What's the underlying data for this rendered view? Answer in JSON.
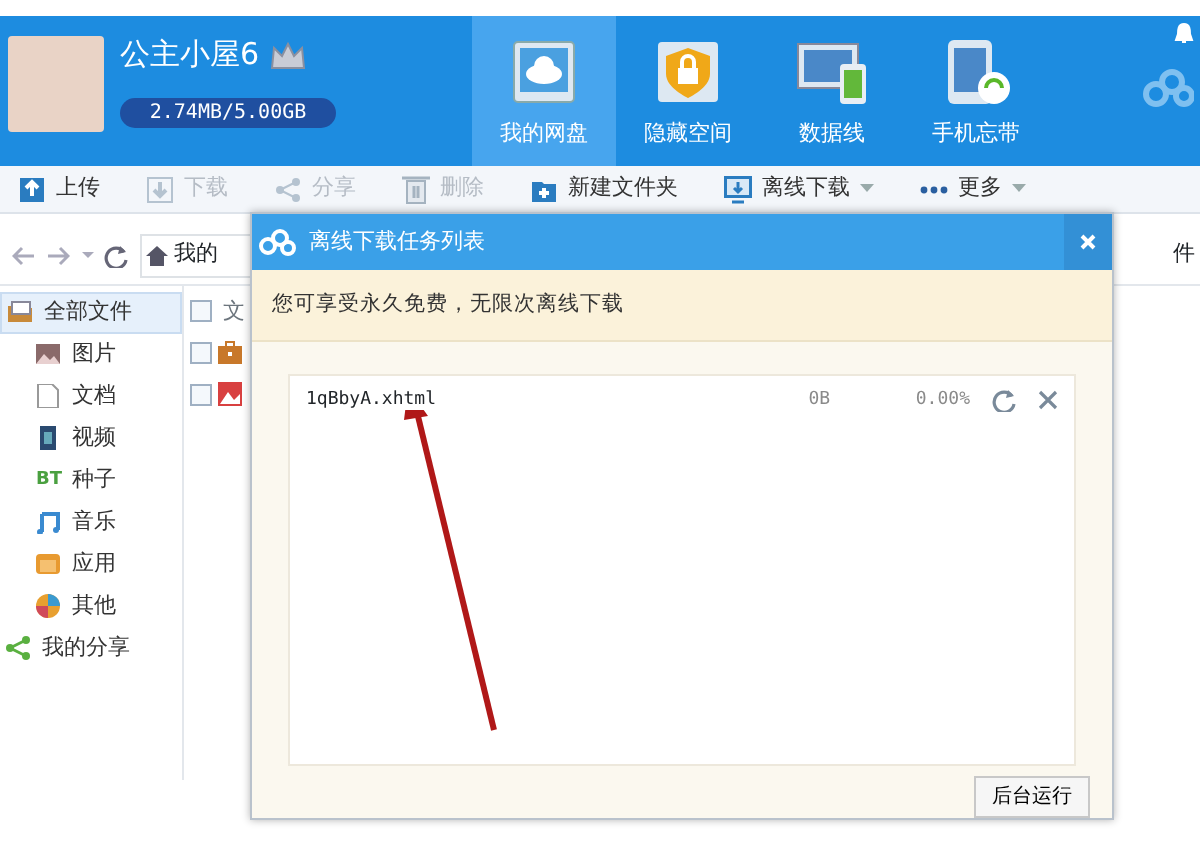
{
  "header": {
    "user_name": "公主小屋6",
    "storage": "2.74MB/5.00GB",
    "tabs": [
      {
        "label": "我的网盘",
        "kind": "cloud",
        "selected": true
      },
      {
        "label": "隐藏空间",
        "kind": "lock",
        "selected": false
      },
      {
        "label": "数据线",
        "kind": "devices",
        "selected": false
      },
      {
        "label": "手机忘带",
        "kind": "phone",
        "selected": false
      }
    ]
  },
  "toolbar": [
    {
      "label": "上传",
      "kind": "upload",
      "disabled": false,
      "dropdown": false
    },
    {
      "label": "下载",
      "kind": "download",
      "disabled": true,
      "dropdown": false
    },
    {
      "label": "分享",
      "kind": "share",
      "disabled": true,
      "dropdown": false
    },
    {
      "label": "删除",
      "kind": "delete",
      "disabled": true,
      "dropdown": false
    },
    {
      "label": "新建文件夹",
      "kind": "folder",
      "disabled": false,
      "dropdown": false
    },
    {
      "label": "离线下载",
      "kind": "offline",
      "disabled": false,
      "dropdown": true
    },
    {
      "label": "更多",
      "kind": "more",
      "disabled": false,
      "dropdown": true
    }
  ],
  "nav": {
    "path": "我的",
    "search": "件"
  },
  "sidebar": {
    "items": [
      {
        "label": "全部文件",
        "kind": "all",
        "selected": true
      },
      {
        "label": "图片",
        "kind": "picture",
        "selected": false
      },
      {
        "label": "文档",
        "kind": "doc",
        "selected": false
      },
      {
        "label": "视频",
        "kind": "video",
        "selected": false
      },
      {
        "label": "种子",
        "kind": "bt",
        "icon_text": "BT",
        "selected": false
      },
      {
        "label": "音乐",
        "kind": "music",
        "selected": false
      },
      {
        "label": "应用",
        "kind": "app",
        "selected": false
      },
      {
        "label": "其他",
        "kind": "other",
        "selected": false
      },
      {
        "label": "我的分享",
        "kind": "share",
        "selected": false
      }
    ]
  },
  "file_list": {
    "header": "文",
    "header_checked": false,
    "rows": [
      {
        "kind": "toolbox",
        "checked": false
      },
      {
        "kind": "image",
        "checked": false
      }
    ]
  },
  "dialog": {
    "title": "离线下载任务列表",
    "notice": "您可享受永久免费，无限次离线下载",
    "tasks": [
      {
        "name": "1qBbyA.xhtml",
        "size": "0B",
        "percentage": "0.00%"
      }
    ],
    "button": "后台运行"
  }
}
